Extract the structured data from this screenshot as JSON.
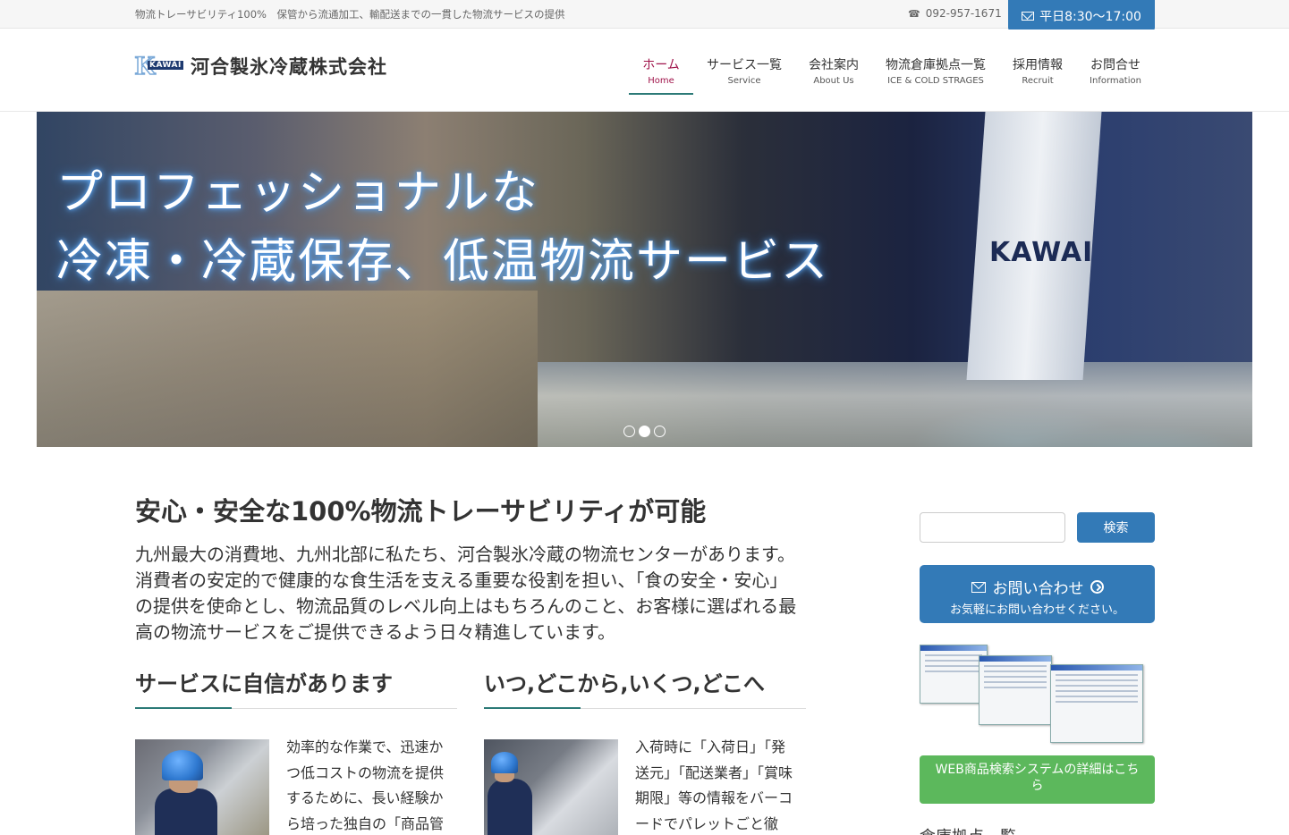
{
  "topbar": {
    "tagline": "物流トレーサビリティ100%　保管から流通加工、輸配送までの一貫した物流サービスの提供",
    "phone": "092-957-1671",
    "hours": "平日8:30〜17:00"
  },
  "header": {
    "logo_mark": "KAWAI",
    "company_name": "河合製氷冷蔵株式会社"
  },
  "nav": {
    "items": [
      {
        "jp": "ホーム",
        "en": "Home",
        "active": true
      },
      {
        "jp": "サービス一覧",
        "en": "Service"
      },
      {
        "jp": "会社案内",
        "en": "About Us"
      },
      {
        "jp": "物流倉庫拠点一覧",
        "en": "ICE & COLD STRAGES"
      },
      {
        "jp": "採用情報",
        "en": "Recruit"
      },
      {
        "jp": "お問合せ",
        "en": "Information"
      }
    ]
  },
  "hero": {
    "line1": "プロフェッショナルな",
    "line2": "冷凍・冷蔵保存、低温物流サービス",
    "bag_text": "KAWAI",
    "slide_count": 3,
    "active_slide": 2
  },
  "main": {
    "title": "安心・安全な100%物流トレーサビリティが可能",
    "intro": "九州最大の消費地、九州北部に私たち、河合製氷冷蔵の物流センターがあります。消費者の安定的で健康的な食生活を支える重要な役割を担い、「食の安全・安心」の提供を使命とし、物流品質のレベル向上はもちろんのこと、お客様に選ばれる最高の物流サービスをご提供できるよう日々精進しています。",
    "columns": [
      {
        "title": "サービスに自信があります",
        "text": "効率的な作業で、迅速かつ低コストの物流を提供するために、長い経験から培った独自の「商品管"
      },
      {
        "title": "いつ,どこから,いくつ,どこへ",
        "text": "入荷時に「入荷日」「発送元」「配送業者」「賞味期限」等の情報をバーコードでパレットごと徹"
      }
    ]
  },
  "sidebar": {
    "search_placeholder": "",
    "search_button": "検索",
    "contact_title": "お問い合わせ",
    "contact_sub": "お気軽にお問い合わせください。",
    "web_button": "WEB商品検索システムの詳細はこちら",
    "heading": "倉庫拠点一覧"
  },
  "colors": {
    "primary": "#337ab7",
    "active_nav": "#a0154b",
    "accent_rule": "#2c7a77",
    "green_button": "#5cb85c"
  }
}
